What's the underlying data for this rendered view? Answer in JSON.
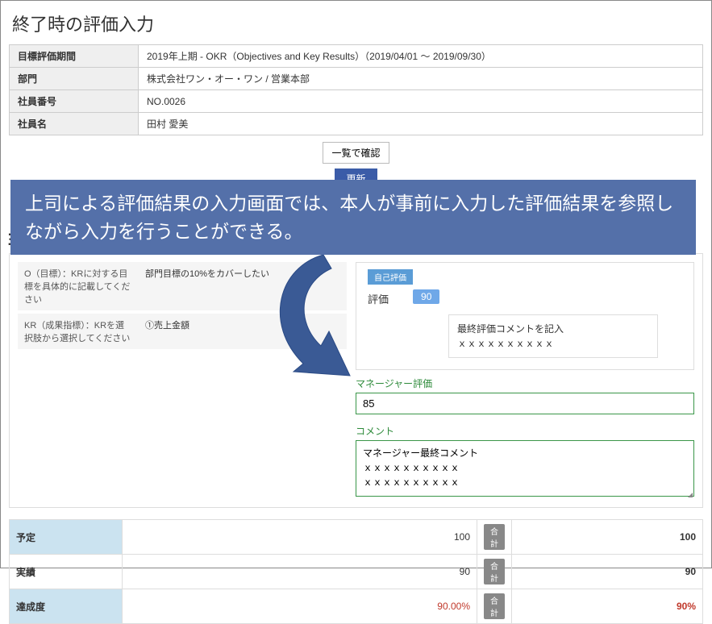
{
  "page_title": "終了時の評価入力",
  "info": {
    "period_label": "目標評価期間",
    "period_value": "2019年上期 - OKR（Objectives and Key Results）（2019/04/01 ～ 2019/09/30）",
    "dept_label": "部門",
    "dept_value": "株式会社ワン・オー・ワン / 営業本部",
    "emp_no_label": "社員番号",
    "emp_no_value": "NO.0026",
    "emp_name_label": "社員名",
    "emp_name_value": "田村 愛美"
  },
  "buttons": {
    "list_confirm": "一覧で確認",
    "update": "更新"
  },
  "annotation": "上司による評価結果の入力画面では、本人が事前に入力した評価結果を参照しながら入力を行うことができる。",
  "okr": {
    "o_label": "O（目標）：KRに対する目標を具体的に記載してください",
    "o_value": "部門目標の10%をカバーしたい",
    "kr_label": "KR（成果指標）：KRを選択肢から選択してください",
    "kr_value": "①売上金額"
  },
  "self_eval": {
    "tag": "自己評価",
    "label": "評価",
    "score": "90",
    "comment_title": "最終評価コメントを記入",
    "comment_body": "ｘｘｘｘｘｘｘｘｘｘ"
  },
  "mgr_eval": {
    "score_label": "マネージャー評価",
    "score_value": "85",
    "comment_label": "コメント",
    "comment_value": "マネージャー最終コメント\nｘｘｘｘｘｘｘｘｘｘ\nｘｘｘｘｘｘｘｘｘｘ"
  },
  "summary": {
    "planned_label": "予定",
    "planned_value": "100",
    "planned_total": "100",
    "actual_label": "実績",
    "actual_value": "90",
    "actual_total": "90",
    "rate_label": "達成度",
    "rate_value": "90.00%",
    "rate_total": "90%",
    "total_badge": "合計"
  }
}
